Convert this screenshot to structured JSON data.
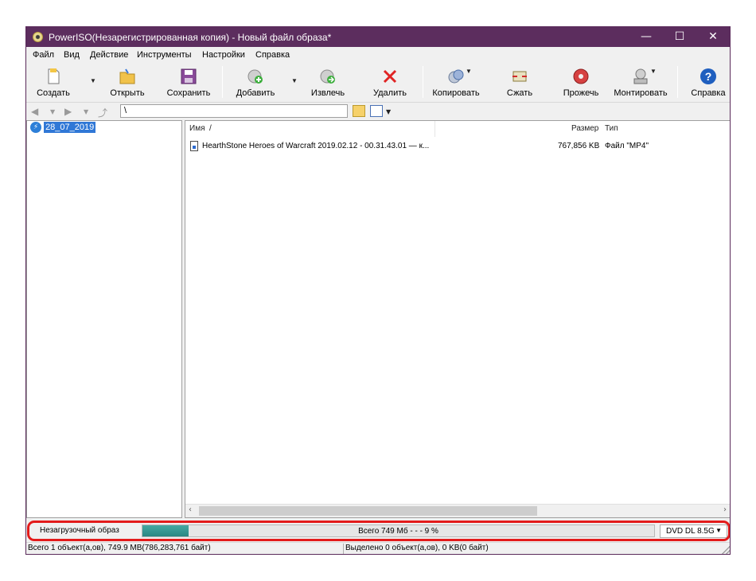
{
  "window": {
    "title": "PowerISO(Незарегистрированная копия) - Новый файл образа*",
    "controls": {
      "minimize": "—",
      "maximize": "☐",
      "close": "✕"
    },
    "titlebar_color": "#5c2d5e"
  },
  "menu": [
    "Файл",
    "Вид",
    "Действие",
    "Инструменты",
    "Настройки",
    "Справка"
  ],
  "toolbar": {
    "create": "Создать",
    "open": "Открыть",
    "save": "Сохранить",
    "add": "Добавить",
    "extract": "Извлечь",
    "delete": "Удалить",
    "copy": "Копировать",
    "compress": "Сжать",
    "burn": "Прожечь",
    "mount": "Монтировать",
    "help": "Справка"
  },
  "nav": {
    "path": "\\"
  },
  "tree": {
    "root": "28_07_2019"
  },
  "list": {
    "columns": {
      "name": "Имя",
      "sort_indicator": "/",
      "size": "Размер",
      "type": "Тип"
    },
    "rows": [
      {
        "name": "HearthStone  Heroes of Warcraft 2019.02.12 - 00.31.43.01 — к...",
        "size": "767,856 KB",
        "type": "Файл \"MP4\""
      }
    ]
  },
  "capacity": {
    "boot_type": "Незагрузочный образ",
    "summary": "Всего  749 Мб   - - -  9 %",
    "used_fraction": 0.09,
    "disc_type": "DVD DL 8.5G",
    "highlight_color": "#e31b1b"
  },
  "status": {
    "total": "Всего 1 объект(а,ов), 749.9 MB(786,283,761 байт)",
    "selected": "Выделено 0 объект(а,ов), 0 KB(0 байт)"
  }
}
